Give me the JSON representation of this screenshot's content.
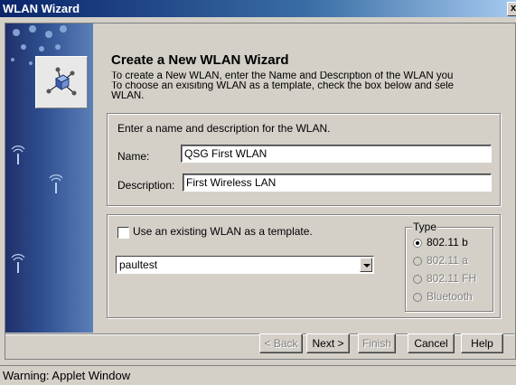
{
  "window": {
    "title": "WLAN Wizard",
    "close_glyph": "x"
  },
  "header": {
    "title": "Create a New WLAN Wizard",
    "description_lines": [
      "To create a New WLAN, enter the Name and Description of the WLAN you",
      "To choose an exisiting WLAN as a template, check the box below and sele",
      "WLAN."
    ]
  },
  "name_group": {
    "instruction": "Enter a name and description for the WLAN.",
    "name_label": "Name:",
    "name_value": "QSG First WLAN",
    "description_label": "Description:",
    "description_value": "First Wireless LAN"
  },
  "template_group": {
    "checkbox_label": "Use an existing WLAN as a template.",
    "checked": false,
    "select_value": "paultest",
    "type_title": "Type",
    "type_options": [
      {
        "label": "802.11 b",
        "selected": true,
        "enabled": true
      },
      {
        "label": "802.11 a",
        "selected": false,
        "enabled": false
      },
      {
        "label": "802.11 FH",
        "selected": false,
        "enabled": false
      },
      {
        "label": "Bluetooth",
        "selected": false,
        "enabled": false
      }
    ]
  },
  "buttons": {
    "back": "< Back",
    "next": "Next >",
    "finish": "Finish",
    "cancel": "Cancel",
    "help": "Help"
  },
  "status": {
    "text": "Warning: Applet Window"
  },
  "icons": {
    "side_logo": "network-cube-icon",
    "radio_waves": "wireless-signal-icon"
  },
  "colors": {
    "title_bar": "#0a246a",
    "side_panel": "#2e4d8e",
    "face": "#d4d0c8"
  }
}
